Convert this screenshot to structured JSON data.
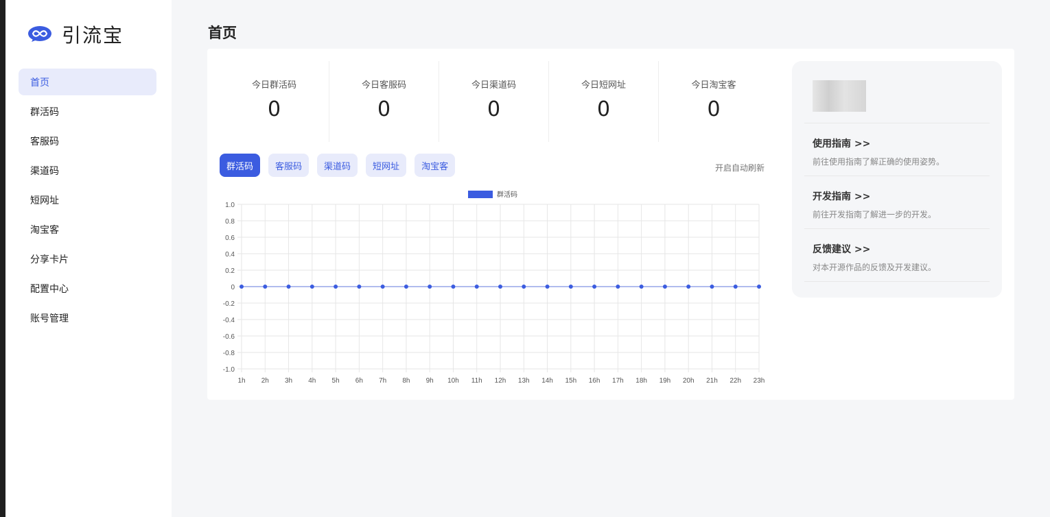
{
  "brand": {
    "name": "引流宝",
    "logo_icon": "infinity-chat-icon",
    "color": "#3b5ce0"
  },
  "sidebar": {
    "items": [
      {
        "label": "首页",
        "active": true
      },
      {
        "label": "群活码"
      },
      {
        "label": "客服码"
      },
      {
        "label": "渠道码"
      },
      {
        "label": "短网址"
      },
      {
        "label": "淘宝客"
      },
      {
        "label": "分享卡片"
      },
      {
        "label": "配置中心"
      },
      {
        "label": "账号管理"
      }
    ]
  },
  "page": {
    "title": "首页"
  },
  "stats": [
    {
      "label": "今日群活码",
      "value": "0"
    },
    {
      "label": "今日客服码",
      "value": "0"
    },
    {
      "label": "今日渠道码",
      "value": "0"
    },
    {
      "label": "今日短网址",
      "value": "0"
    },
    {
      "label": "今日淘宝客",
      "value": "0"
    }
  ],
  "tabs": [
    {
      "label": "群活码",
      "active": true
    },
    {
      "label": "客服码"
    },
    {
      "label": "渠道码"
    },
    {
      "label": "短网址"
    },
    {
      "label": "淘宝客"
    }
  ],
  "auto_refresh_label": "开启自动刷新",
  "guides": [
    {
      "title": "使用指南 >>",
      "desc": "前往使用指南了解正确的使用姿势。"
    },
    {
      "title": "开发指南 >>",
      "desc": "前往开发指南了解进一步的开发。"
    },
    {
      "title": "反馈建议 >>",
      "desc": "对本开源作品的反馈及开发建议。"
    }
  ],
  "chart_data": {
    "type": "line",
    "x": [
      "1h",
      "2h",
      "3h",
      "4h",
      "5h",
      "6h",
      "7h",
      "8h",
      "9h",
      "10h",
      "11h",
      "12h",
      "13h",
      "14h",
      "15h",
      "16h",
      "17h",
      "18h",
      "19h",
      "20h",
      "21h",
      "22h",
      "23h"
    ],
    "series": [
      {
        "name": "群活码",
        "values": [
          0,
          0,
          0,
          0,
          0,
          0,
          0,
          0,
          0,
          0,
          0,
          0,
          0,
          0,
          0,
          0,
          0,
          0,
          0,
          0,
          0,
          0,
          0
        ],
        "color": "#3b5ce0"
      }
    ],
    "ylim": [
      -1.0,
      1.0
    ],
    "yticks": [
      "1.0",
      "0.8",
      "0.6",
      "0.4",
      "0.2",
      "0",
      "-0.2",
      "-0.4",
      "-0.6",
      "-0.8",
      "-1.0"
    ],
    "grid": true,
    "legend": "top-center"
  }
}
